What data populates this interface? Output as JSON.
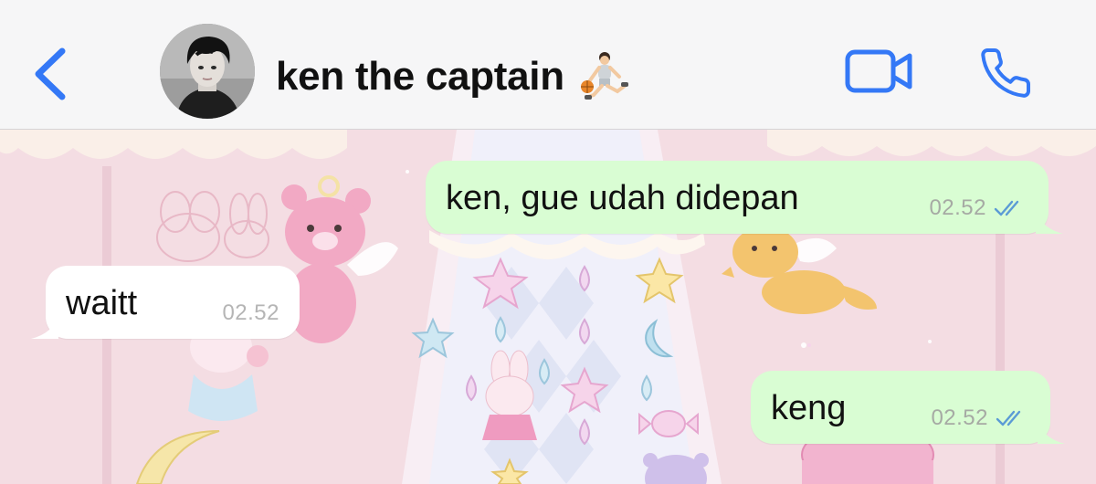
{
  "header": {
    "contact_name": "ken the captain",
    "status_emoji": "person-bouncing-ball-emoji",
    "icons": {
      "back": "chevron-left-icon",
      "video": "video-camera-icon",
      "call": "phone-icon"
    },
    "accent_color": "#3478f6"
  },
  "messages": [
    {
      "direction": "outgoing",
      "text": "ken, gue udah didepan",
      "time": "02.52",
      "status": "read"
    },
    {
      "direction": "incoming",
      "text": "waitt",
      "time": "02.52"
    },
    {
      "direction": "outgoing",
      "text": "keng",
      "time": "02.52",
      "status": "read"
    }
  ],
  "colors": {
    "outgoing_bubble": "#d9fdd3",
    "incoming_bubble": "#ffffff",
    "read_ticks": "#5b9bd5",
    "wallpaper": "#f4dde3"
  }
}
